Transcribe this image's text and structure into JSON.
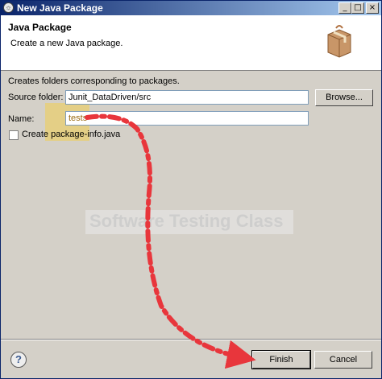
{
  "window": {
    "title": "New Java Package",
    "controls": {
      "minimize": "_",
      "maximize": "□",
      "close": "×"
    }
  },
  "header": {
    "title": "Java Package",
    "description": "Create a new Java package."
  },
  "form": {
    "intro": "Creates folders corresponding to packages.",
    "source_folder_label": "Source folder:",
    "source_folder_value": "Junit_DataDriven/src",
    "browse_label": "Browse...",
    "name_label": "Name:",
    "name_value": "tests",
    "create_info_label": "Create package-info.java",
    "create_info_checked": false
  },
  "watermark": "Software Testing Class",
  "footer": {
    "help_label": "?",
    "finish_label": "Finish",
    "cancel_label": "Cancel"
  },
  "colors": {
    "arrow": "#e8363c",
    "highlight": "#f0cd50",
    "titlebar": "#0a246a"
  },
  "icons": [
    "eclipse-icon",
    "package-icon",
    "help-icon"
  ]
}
